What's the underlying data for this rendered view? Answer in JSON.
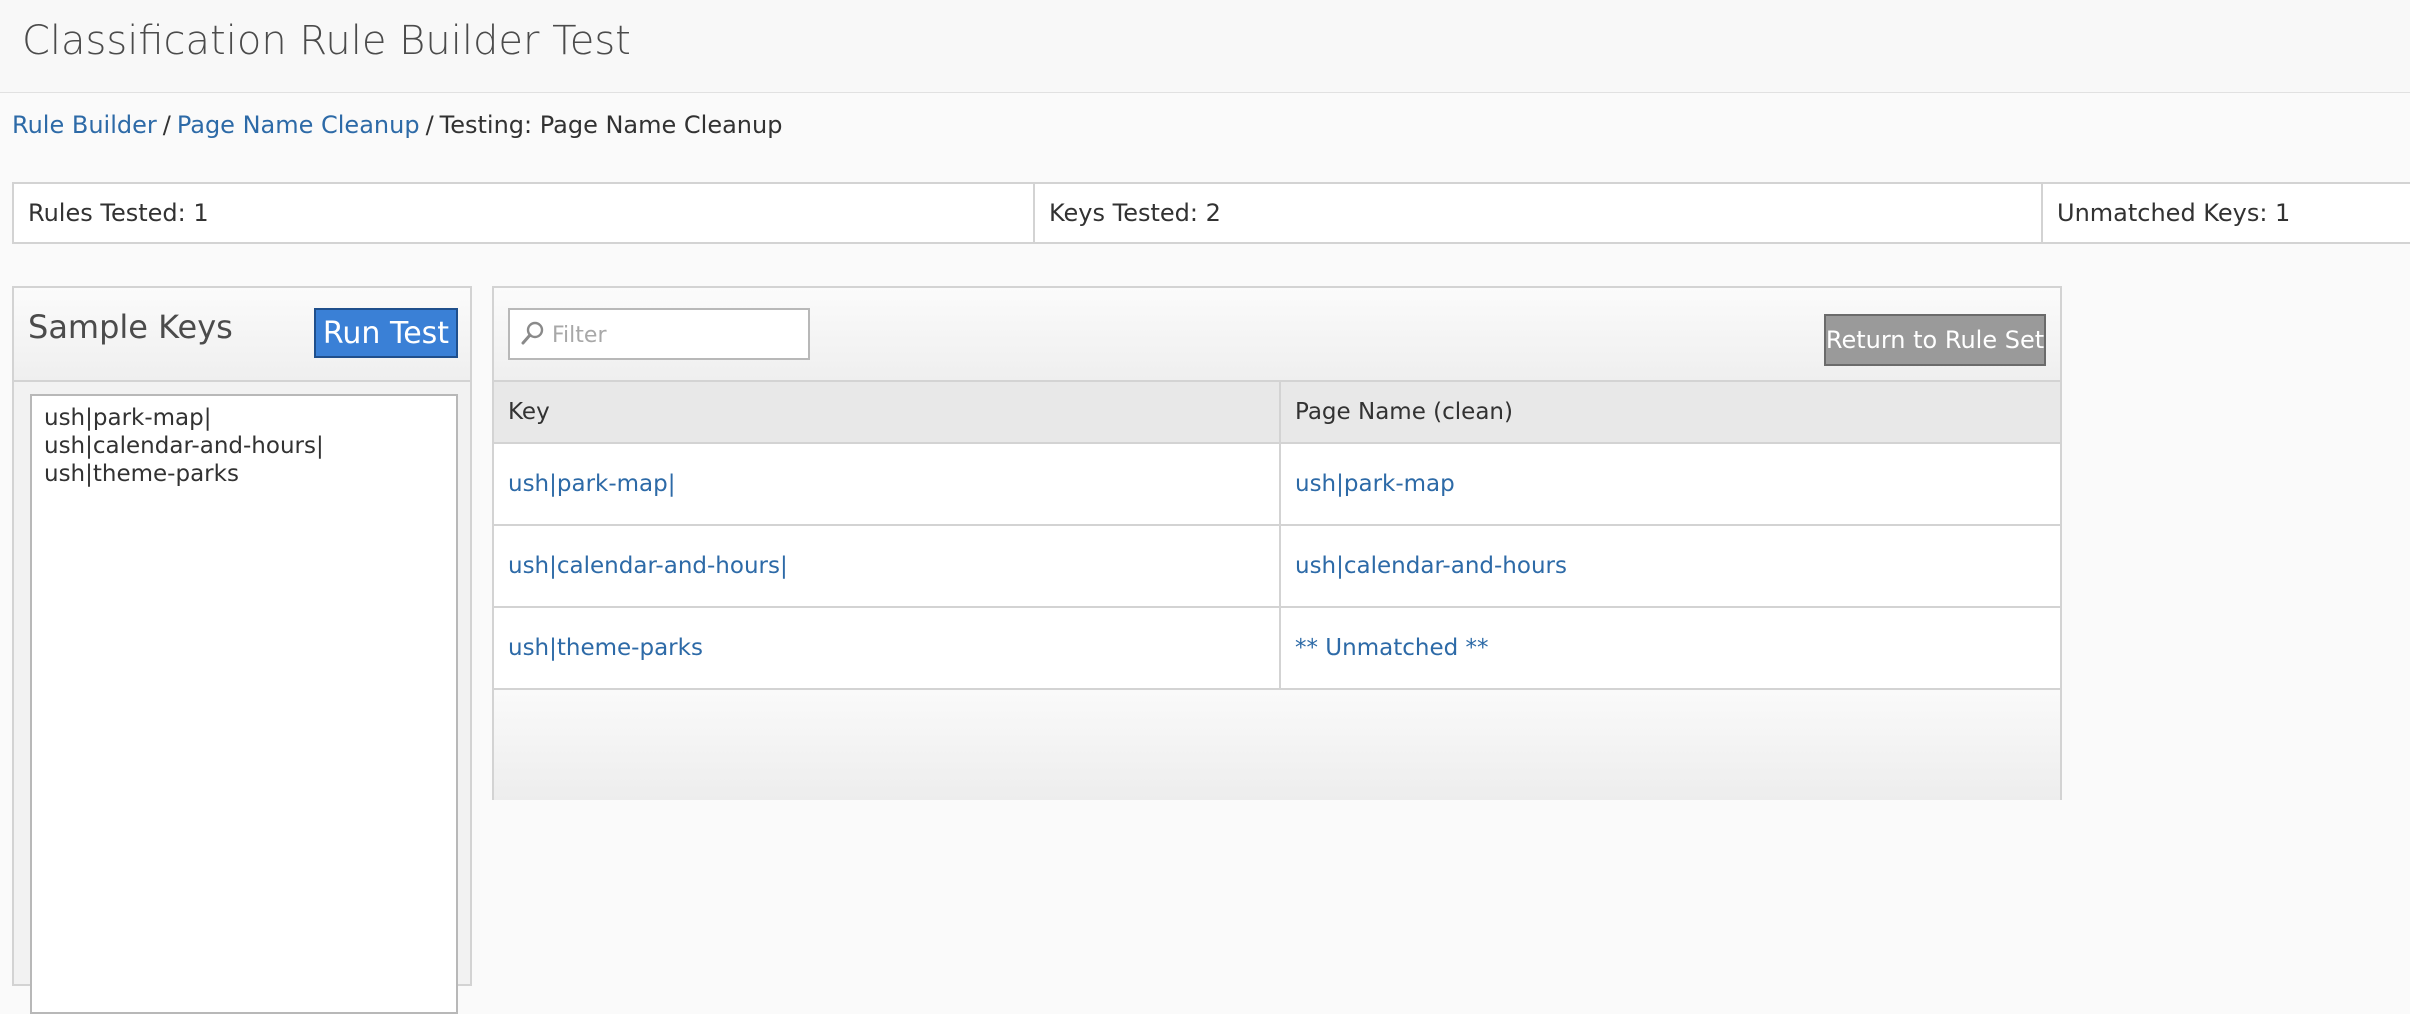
{
  "app": {
    "title": "Classification Rule Builder Test"
  },
  "breadcrumb": {
    "items": [
      {
        "label": "Rule Builder"
      },
      {
        "label": "Page Name Cleanup"
      },
      {
        "label": "Testing: Page Name Cleanup"
      }
    ],
    "separator": "/"
  },
  "stats": {
    "rules_tested": "Rules Tested: 1",
    "keys_tested": "Keys Tested: 2",
    "unmatched_keys": "Unmatched Keys: 1"
  },
  "sample_keys": {
    "title": "Sample Keys",
    "run_button": "Run Test",
    "lines": [
      "ush|park-map|",
      "ush|calendar-and-hours|",
      "ush|theme-parks"
    ]
  },
  "results": {
    "filter_placeholder": "Filter",
    "return_button": "Return to Rule Set",
    "columns": [
      "Key",
      "Page Name (clean)"
    ],
    "rows": [
      {
        "key": "ush|park-map|",
        "value": "ush|park-map"
      },
      {
        "key": "ush|calendar-and-hours|",
        "value": "ush|calendar-and-hours"
      },
      {
        "key": "ush|theme-parks",
        "value": "** Unmatched **"
      }
    ]
  },
  "colors": {
    "accent": "#3a80d6",
    "link": "#2d6aa7",
    "border": "#d3d3d3"
  },
  "icons": {
    "filter": "search-icon"
  }
}
